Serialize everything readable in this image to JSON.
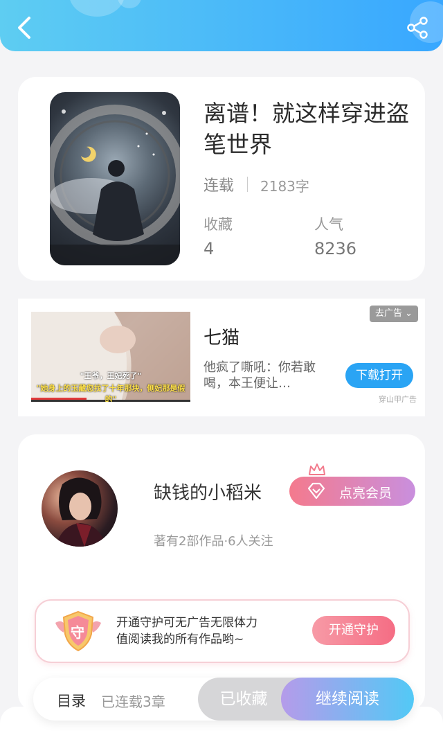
{
  "header": {
    "back_icon": "back-arrow-icon",
    "share_icon": "share-icon"
  },
  "book": {
    "title": "离谱！就这样穿进盗笔世界",
    "status": "连载",
    "word_count": "2183字",
    "favorites_label": "收藏",
    "favorites_value": "4",
    "popularity_label": "人气",
    "popularity_value": "8236"
  },
  "ad": {
    "image_caption_line1": "\"王爷，王妃死了\"",
    "image_caption_line2": "\"她身上的玉藏您找了十年那块，侧妃那是假的\"",
    "title": "七猫",
    "description": "他疯了嘶吼：你若敢喝，本王便让…",
    "close_label": "去广告",
    "download_label": "下载打开",
    "source": "穿山甲广告"
  },
  "author": {
    "name": "缺钱的小稻米",
    "meta": "著有2部作品·6人关注",
    "vip_button": "点亮会员",
    "guard_badge": "守",
    "guard_text_line1": "开通守护可无广告无限体力",
    "guard_text_line2": "值阅读我的所有作品哟~",
    "guard_button": "开通守护"
  },
  "bottom": {
    "toc_label": "目录",
    "chapter_count": "已连载3章",
    "collected_label": "已收藏",
    "read_label": "继续阅读"
  },
  "colors": {
    "header_gradient_start": "#5ecdf2",
    "header_gradient_end": "#38a7ff",
    "accent_blue": "#2aa4f4",
    "vip_pink": "#f47a8d",
    "guard_red": "#f56d84"
  }
}
